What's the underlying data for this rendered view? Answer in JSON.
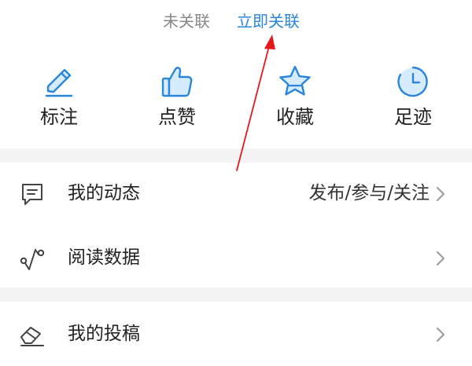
{
  "link": {
    "status": "未关联",
    "action": "立即关联"
  },
  "quick_actions": [
    {
      "label": "标注",
      "icon": "pencil-icon"
    },
    {
      "label": "点赞",
      "icon": "thumbs-up-icon"
    },
    {
      "label": "收藏",
      "icon": "star-icon"
    },
    {
      "label": "足迹",
      "icon": "history-clock-icon"
    }
  ],
  "menu": [
    {
      "label": "我的动态",
      "sub": "发布/参与/关注",
      "icon": "message-icon"
    },
    {
      "label": "阅读数据",
      "sub": "",
      "icon": "trend-line-icon"
    },
    {
      "label": "我的投稿",
      "sub": "",
      "icon": "eraser-icon"
    }
  ],
  "colors": {
    "accent": "#2b86d9",
    "icon_fill": "#d6ebfb",
    "icon_stroke": "#2b86d9",
    "annotation": "#e3191c",
    "divider": "#f4f4f4"
  }
}
